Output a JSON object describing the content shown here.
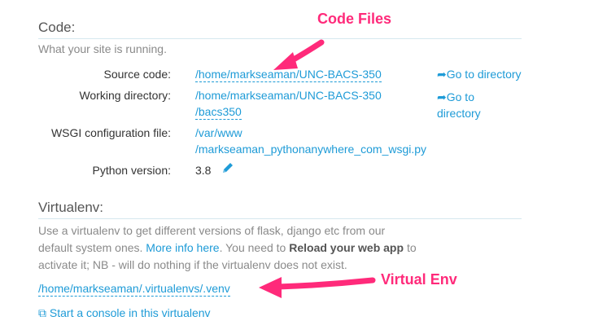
{
  "code": {
    "title": "Code:",
    "subtitle": "What your site is running.",
    "source_code": {
      "label": "Source code:",
      "value": "/home/markseaman/UNC-BACS-350",
      "goto": "Go to directory"
    },
    "working_dir": {
      "label": "Working directory:",
      "value_line1": "/home/markseaman/UNC-BACS-350",
      "value_line2": "/bacs350",
      "goto_line1": "Go to",
      "goto_line2": "directory"
    },
    "wsgi": {
      "label": "WSGI configuration file:",
      "value_line1": "/var/www",
      "value_line2": "/markseaman_pythonanywhere_com_wsgi.py"
    },
    "python": {
      "label": "Python version:",
      "value": "3.8"
    }
  },
  "virtualenv": {
    "title": "Virtualenv:",
    "para_part1": "Use a virtualenv to get different versions of flask, django etc from our",
    "para_part2": "default system ones.",
    "more_info": "More info here",
    "para_part3": ". You need to",
    "reload_bold": "Reload your web app",
    "para_part4": "to",
    "para_part5": "activate it; NB - will do nothing if the virtualenv does not exist.",
    "path": "/home/markseaman/.virtualenvs/.venv",
    "console_link": "Start a console in this virtualenv"
  },
  "annotations": {
    "code_files": "Code Files",
    "virtual_env": "Virtual Env",
    "color": "#ff2a7a"
  },
  "colors": {
    "link": "#1e9bd7",
    "rule": "#d6e8ef"
  }
}
